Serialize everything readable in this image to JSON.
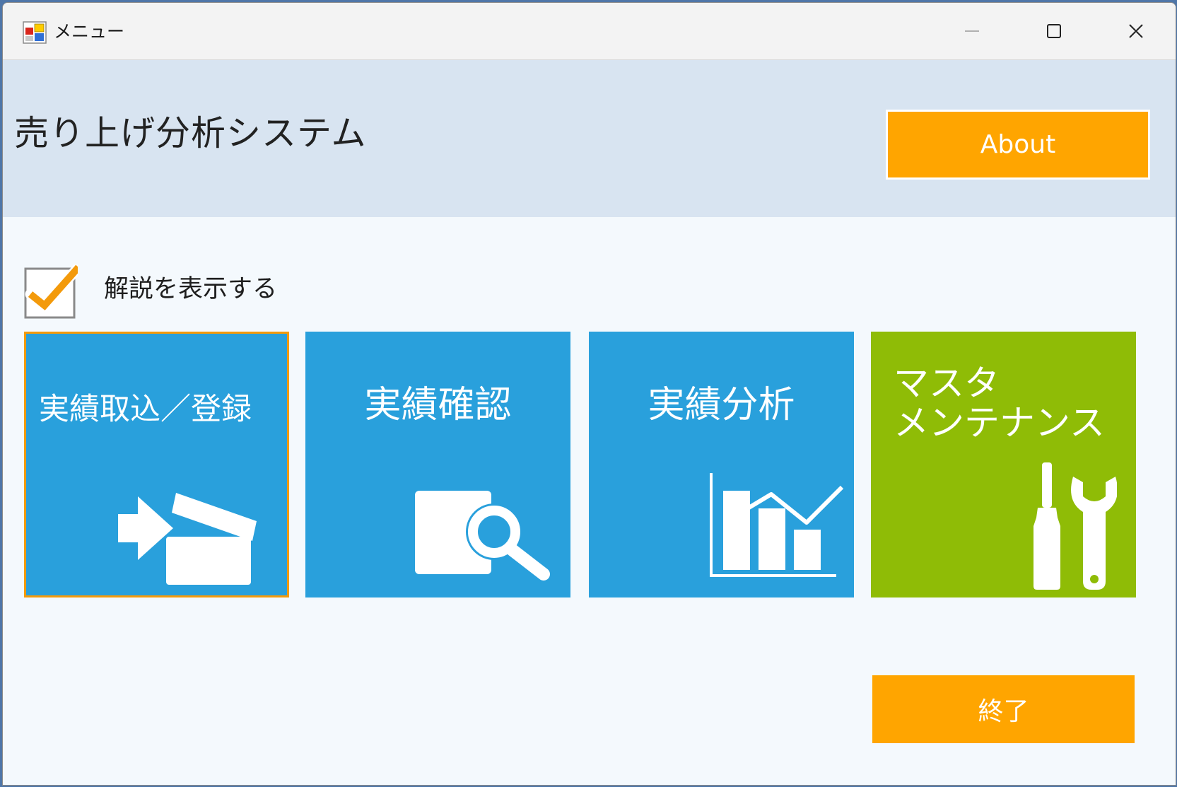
{
  "window": {
    "title": "メニュー",
    "controls": {
      "minimize_icon": "minimize-icon",
      "maximize_icon": "maximize-icon",
      "close_icon": "close-icon"
    }
  },
  "header": {
    "app_title": "売り上げ分析システム",
    "about_label": "About",
    "background_color": "#d8e4f1"
  },
  "options": {
    "show_explanation_label": "解説を表示する",
    "show_explanation_checked": true
  },
  "tiles": [
    {
      "label": "実績取込／登録",
      "icon": "import-box-icon",
      "color": "#29a0dc",
      "selected": true
    },
    {
      "label": "実績確認",
      "icon": "document-search-icon",
      "color": "#29a0dc",
      "selected": false
    },
    {
      "label": "実績分析",
      "icon": "bar-line-chart-icon",
      "color": "#29a0dc",
      "selected": false
    },
    {
      "label": "マスタ\nメンテナンス",
      "icon": "tools-icon",
      "color": "#8fbc06",
      "selected": false
    }
  ],
  "footer": {
    "exit_label": "終了"
  },
  "colors": {
    "accent": "#ffa500",
    "tile_blue": "#29a0dc",
    "tile_green": "#8fbc06",
    "selection_border": "#f39a0b"
  }
}
